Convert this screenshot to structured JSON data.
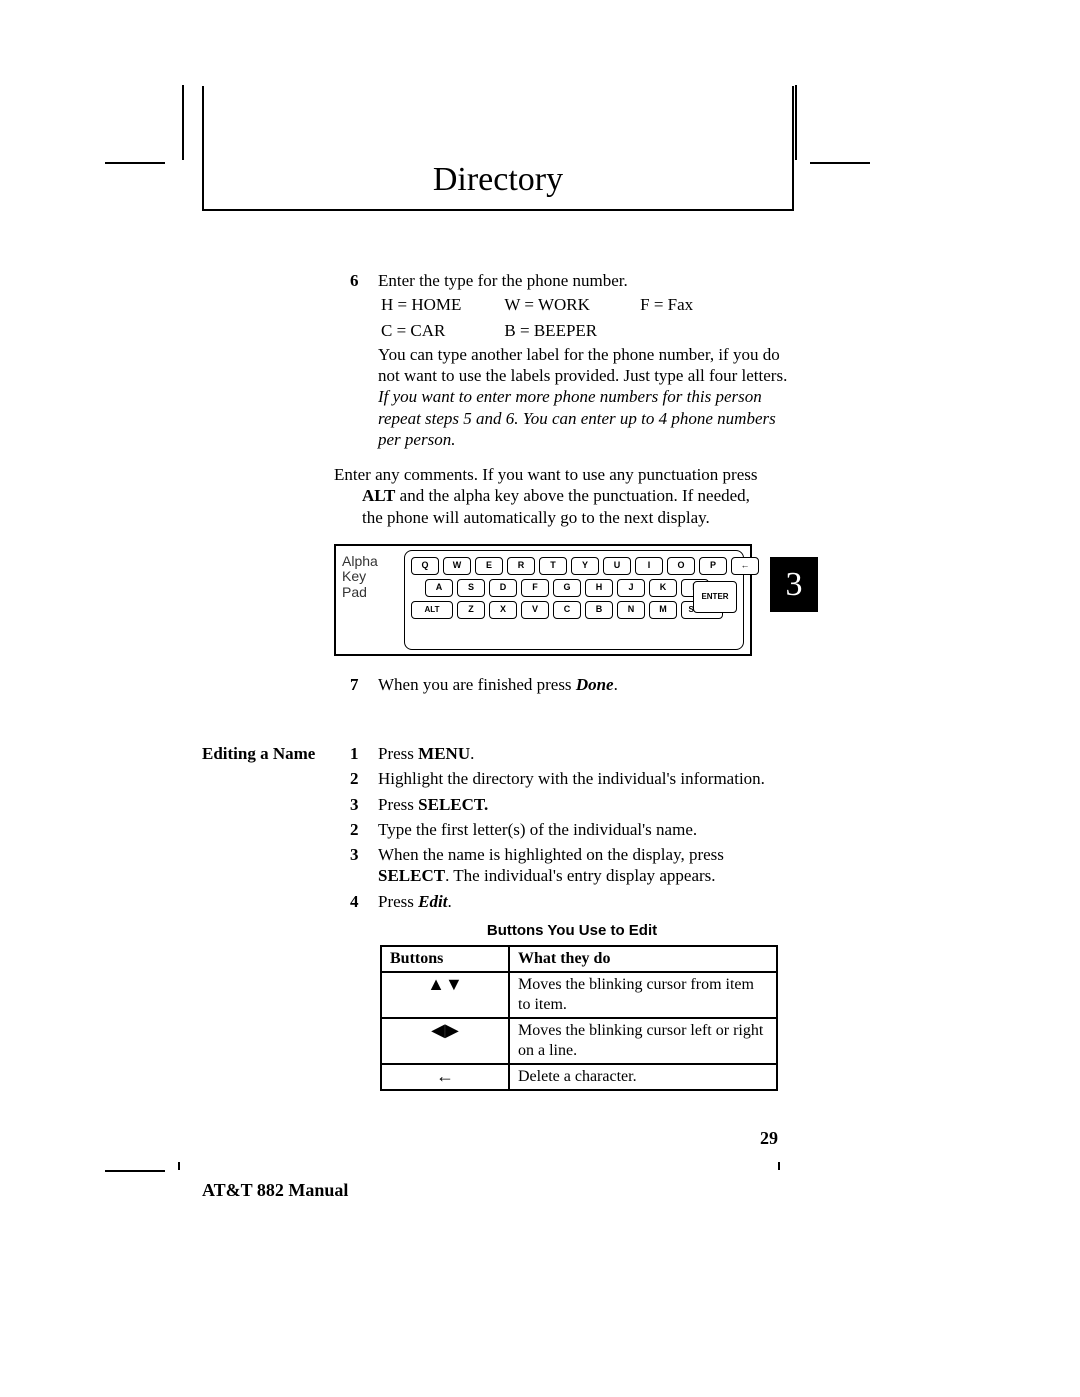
{
  "title": "Directory",
  "chapter_number": "3",
  "page_number": "29",
  "footer": "AT&T 882 Manual",
  "step6": {
    "num": "6",
    "intro": "Enter the type for the phone number.",
    "codes": {
      "r1c1": "H = HOME",
      "r1c2": "W = WORK",
      "r1c3": "F = Fax",
      "r2c1": "C = CAR",
      "r2c2": "B = BEEPER"
    },
    "note": "You can type another label for the phone number, if you do not want to use the labels provided.  Just type all four letters.",
    "italic": "If you want to enter more phone numbers for this person repeat steps 5 and 6.  You can enter up to 4 phone numbers per person."
  },
  "comments": {
    "line1": "Enter any comments.  If you want to use any punctuation press",
    "alt": "ALT",
    "line2": " and the alpha key above the punctuation.  If needed, the phone will automatically go to the next display."
  },
  "keypad": {
    "label_l1": "Alpha",
    "label_l2": "Key",
    "label_l3": "Pad",
    "row1": [
      "Q",
      "W",
      "E",
      "R",
      "T",
      "Y",
      "U",
      "I",
      "O",
      "P",
      "←"
    ],
    "row2": [
      "A",
      "S",
      "D",
      "F",
      "G",
      "H",
      "J",
      "K",
      "L"
    ],
    "row3": [
      "ALT",
      "Z",
      "X",
      "V",
      "C",
      "B",
      "N",
      "M",
      "SPACE"
    ],
    "enter": "ENTER"
  },
  "step7": {
    "num": "7",
    "pre": "When you are finished press ",
    "done": "Done",
    "post": "."
  },
  "editing": {
    "heading": "Editing a Name",
    "s1": {
      "n": "1",
      "pre": "Press ",
      "b": "MENU",
      "post": "."
    },
    "s2": {
      "n": "2",
      "t": "Highlight the directory with the individual's information."
    },
    "s3": {
      "n": "3",
      "pre": "Press ",
      "b": "SELECT."
    },
    "s4": {
      "n": "2",
      "t": "Type the first letter(s) of the individual's name."
    },
    "s5": {
      "n": "3",
      "pre": "When the name is highlighted on the display, press ",
      "b": "SELECT",
      "post": ".  The individual's entry display appears."
    },
    "s6": {
      "n": "4",
      "pre": "Press ",
      "i": "Edit",
      "post": "."
    }
  },
  "table": {
    "title": "Buttons You Use to Edit",
    "h1": "Buttons",
    "h2": "What they do",
    "r1_icon": "▲▼",
    "r1_text": "Moves the blinking cursor from item to item.",
    "r2_icon": "◀▶",
    "r2_text": "Moves the blinking cursor left or right on a line.",
    "r3_icon": "←",
    "r3_text": "Delete a character."
  }
}
